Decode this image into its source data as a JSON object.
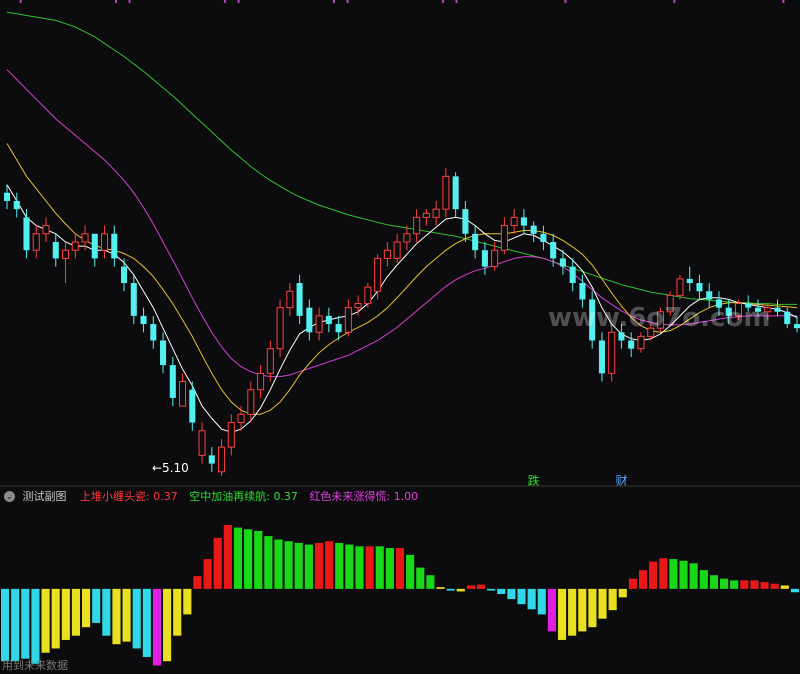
{
  "main_chart": {
    "low_marker": "←5.10",
    "event_labels": [
      {
        "text": "跌",
        "color": "#2ee02e",
        "index": 54
      },
      {
        "text": "财",
        "color": "#5aa8ff",
        "index": 63
      }
    ],
    "watermark": "www.6o7o.com",
    "colors": {
      "up": "#ff4040",
      "down": "#54f0f0",
      "ma_fast": "#ffffff",
      "ma_mid": "#e8c030",
      "ma_slow": "#d040d0",
      "ma_long": "#30c030"
    }
  },
  "sub_chart": {
    "title": "测试副图",
    "series": [
      {
        "name": "上堆小缠头瓷",
        "value": "0.37",
        "color": "#ff3a3a"
      },
      {
        "name": "空中加油再续航",
        "value": "0.37",
        "color": "#2ee02e"
      },
      {
        "name": "红色未来涨得慌",
        "value": "1.00",
        "color": "#e040e0"
      }
    ],
    "footer_note": "用到未来数据"
  },
  "chart_data": {
    "type": "candlestick",
    "candles": [
      [
        7.7,
        7.8,
        7.5,
        7.6
      ],
      [
        7.6,
        7.7,
        7.4,
        7.5
      ],
      [
        7.4,
        7.5,
        6.9,
        7.0
      ],
      [
        7.0,
        7.3,
        6.9,
        7.2
      ],
      [
        7.2,
        7.4,
        7.1,
        7.3
      ],
      [
        7.1,
        7.2,
        6.8,
        6.9
      ],
      [
        6.9,
        7.1,
        6.6,
        7.0
      ],
      [
        7.0,
        7.2,
        6.9,
        7.1
      ],
      [
        7.1,
        7.3,
        7.0,
        7.2
      ],
      [
        7.2,
        7.2,
        6.8,
        6.9
      ],
      [
        7.0,
        7.3,
        6.9,
        7.2
      ],
      [
        7.2,
        7.3,
        6.8,
        6.9
      ],
      [
        6.8,
        6.9,
        6.5,
        6.6
      ],
      [
        6.6,
        6.7,
        6.1,
        6.2
      ],
      [
        6.2,
        6.3,
        6.0,
        6.1
      ],
      [
        6.1,
        6.2,
        5.8,
        5.9
      ],
      [
        5.9,
        6.0,
        5.5,
        5.6
      ],
      [
        5.6,
        5.7,
        5.1,
        5.2
      ],
      [
        5.1,
        5.5,
        5.1,
        5.4
      ],
      [
        5.3,
        5.4,
        4.8,
        4.9
      ],
      [
        4.5,
        4.9,
        4.4,
        4.8
      ],
      [
        4.5,
        4.6,
        4.3,
        4.4
      ],
      [
        4.3,
        4.7,
        4.25,
        4.6
      ],
      [
        4.6,
        5.0,
        4.5,
        4.9
      ],
      [
        4.9,
        5.1,
        4.8,
        5.0
      ],
      [
        5.0,
        5.4,
        4.9,
        5.3
      ],
      [
        5.3,
        5.6,
        5.2,
        5.5
      ],
      [
        5.5,
        5.9,
        5.4,
        5.8
      ],
      [
        5.8,
        6.4,
        5.7,
        6.3
      ],
      [
        6.3,
        6.6,
        6.2,
        6.5
      ],
      [
        6.6,
        6.7,
        6.1,
        6.2
      ],
      [
        6.3,
        6.4,
        5.9,
        6.0
      ],
      [
        6.0,
        6.3,
        5.9,
        6.2
      ],
      [
        6.2,
        6.3,
        6.0,
        6.1
      ],
      [
        6.1,
        6.2,
        5.9,
        6.0
      ],
      [
        6.0,
        6.4,
        5.95,
        6.3
      ],
      [
        6.3,
        6.45,
        6.2,
        6.35
      ],
      [
        6.35,
        6.6,
        6.3,
        6.55
      ],
      [
        6.5,
        6.95,
        6.4,
        6.9
      ],
      [
        6.9,
        7.1,
        6.8,
        7.0
      ],
      [
        6.9,
        7.2,
        6.85,
        7.1
      ],
      [
        7.1,
        7.3,
        7.0,
        7.2
      ],
      [
        7.2,
        7.5,
        7.1,
        7.4
      ],
      [
        7.4,
        7.5,
        7.3,
        7.45
      ],
      [
        7.4,
        7.6,
        7.3,
        7.5
      ],
      [
        7.5,
        8.0,
        7.4,
        7.9
      ],
      [
        7.9,
        7.95,
        7.4,
        7.5
      ],
      [
        7.5,
        7.6,
        7.1,
        7.2
      ],
      [
        7.2,
        7.3,
        6.9,
        7.0
      ],
      [
        7.0,
        7.1,
        6.7,
        6.8
      ],
      [
        6.8,
        7.1,
        6.75,
        7.0
      ],
      [
        7.0,
        7.4,
        6.95,
        7.3
      ],
      [
        7.3,
        7.5,
        7.2,
        7.4
      ],
      [
        7.4,
        7.5,
        7.2,
        7.3
      ],
      [
        7.3,
        7.35,
        7.1,
        7.2
      ],
      [
        7.2,
        7.3,
        7.0,
        7.1
      ],
      [
        7.1,
        7.2,
        6.8,
        6.9
      ],
      [
        6.9,
        7.0,
        6.7,
        6.8
      ],
      [
        6.8,
        6.9,
        6.5,
        6.6
      ],
      [
        6.6,
        6.7,
        6.3,
        6.4
      ],
      [
        6.4,
        6.5,
        5.8,
        5.9
      ],
      [
        5.9,
        6.0,
        5.4,
        5.5
      ],
      [
        5.5,
        6.1,
        5.4,
        6.0
      ],
      [
        6.0,
        6.1,
        5.8,
        5.9
      ],
      [
        5.9,
        6.0,
        5.7,
        5.8
      ],
      [
        5.8,
        6.0,
        5.75,
        5.95
      ],
      [
        5.95,
        6.1,
        5.9,
        6.05
      ],
      [
        6.05,
        6.3,
        6.0,
        6.25
      ],
      [
        6.25,
        6.5,
        6.2,
        6.45
      ],
      [
        6.45,
        6.7,
        6.4,
        6.65
      ],
      [
        6.65,
        6.8,
        6.5,
        6.6
      ],
      [
        6.6,
        6.7,
        6.4,
        6.5
      ],
      [
        6.5,
        6.6,
        6.3,
        6.4
      ],
      [
        6.4,
        6.5,
        6.2,
        6.3
      ],
      [
        6.3,
        6.4,
        6.1,
        6.2
      ],
      [
        6.2,
        6.4,
        6.15,
        6.35
      ],
      [
        6.35,
        6.45,
        6.25,
        6.3
      ],
      [
        6.3,
        6.4,
        6.2,
        6.25
      ],
      [
        6.25,
        6.35,
        6.15,
        6.3
      ],
      [
        6.3,
        6.4,
        6.2,
        6.25
      ],
      [
        6.25,
        6.3,
        6.05,
        6.1
      ],
      [
        6.1,
        6.2,
        6.0,
        6.05
      ]
    ],
    "ma_fast": [
      7.8,
      7.6,
      7.4,
      7.3,
      7.25,
      7.2,
      7.1,
      7.05,
      7.05,
      7.0,
      7.0,
      6.95,
      6.85,
      6.7,
      6.5,
      6.3,
      6.05,
      5.8,
      5.55,
      5.35,
      5.1,
      4.95,
      4.82,
      4.78,
      4.82,
      4.92,
      5.08,
      5.3,
      5.55,
      5.78,
      5.98,
      6.06,
      6.12,
      6.15,
      6.18,
      6.2,
      6.25,
      6.35,
      6.5,
      6.68,
      6.82,
      6.95,
      7.08,
      7.18,
      7.28,
      7.38,
      7.4,
      7.38,
      7.3,
      7.2,
      7.12,
      7.1,
      7.15,
      7.2,
      7.18,
      7.12,
      7.05,
      6.98,
      6.88,
      6.75,
      6.55,
      6.3,
      6.1,
      5.98,
      5.92,
      5.9,
      5.92,
      5.98,
      6.08,
      6.2,
      6.32,
      6.4,
      6.42,
      6.42,
      6.4,
      6.36,
      6.34,
      6.32,
      6.3,
      6.28,
      6.24,
      6.18
    ],
    "ma_mid": [
      8.3,
      8.1,
      7.9,
      7.75,
      7.6,
      7.45,
      7.32,
      7.2,
      7.12,
      7.06,
      7.02,
      7.0,
      6.96,
      6.9,
      6.8,
      6.68,
      6.52,
      6.35,
      6.15,
      5.95,
      5.72,
      5.5,
      5.3,
      5.15,
      5.05,
      5.0,
      5.0,
      5.05,
      5.15,
      5.3,
      5.48,
      5.62,
      5.75,
      5.85,
      5.93,
      6.0,
      6.06,
      6.12,
      6.2,
      6.3,
      6.42,
      6.55,
      6.68,
      6.8,
      6.9,
      7.0,
      7.08,
      7.14,
      7.18,
      7.2,
      7.2,
      7.2,
      7.22,
      7.24,
      7.24,
      7.22,
      7.18,
      7.12,
      7.04,
      6.95,
      6.82,
      6.65,
      6.48,
      6.32,
      6.18,
      6.08,
      6.02,
      6.0,
      6.02,
      6.08,
      6.16,
      6.24,
      6.3,
      6.34,
      6.36,
      6.36,
      6.35,
      6.34,
      6.33,
      6.32,
      6.31,
      6.3
    ],
    "ma_slow": [
      9.2,
      9.08,
      8.96,
      8.84,
      8.72,
      8.6,
      8.5,
      8.4,
      8.3,
      8.2,
      8.1,
      7.98,
      7.85,
      7.7,
      7.52,
      7.32,
      7.1,
      6.88,
      6.65,
      6.42,
      6.2,
      6.0,
      5.82,
      5.68,
      5.58,
      5.52,
      5.48,
      5.46,
      5.46,
      5.48,
      5.52,
      5.56,
      5.6,
      5.64,
      5.68,
      5.72,
      5.78,
      5.84,
      5.9,
      5.98,
      6.06,
      6.16,
      6.26,
      6.36,
      6.46,
      6.56,
      6.64,
      6.7,
      6.75,
      6.78,
      6.82,
      6.86,
      6.9,
      6.92,
      6.92,
      6.9,
      6.86,
      6.8,
      6.72,
      6.62,
      6.52,
      6.42,
      6.34,
      6.26,
      6.2,
      6.15,
      6.12,
      6.1,
      6.09,
      6.09,
      6.1,
      6.12,
      6.14,
      6.16,
      6.18,
      6.19,
      6.2,
      6.2,
      6.2,
      6.2,
      6.2,
      6.2
    ],
    "ma_long": [
      9.9,
      9.88,
      9.86,
      9.84,
      9.82,
      9.8,
      9.76,
      9.72,
      9.66,
      9.6,
      9.52,
      9.44,
      9.36,
      9.27,
      9.18,
      9.08,
      8.98,
      8.88,
      8.77,
      8.66,
      8.55,
      8.44,
      8.33,
      8.22,
      8.12,
      8.02,
      7.93,
      7.85,
      7.78,
      7.71,
      7.65,
      7.6,
      7.55,
      7.51,
      7.47,
      7.43,
      7.4,
      7.37,
      7.34,
      7.31,
      7.29,
      7.27,
      7.25,
      7.23,
      7.21,
      7.19,
      7.17,
      7.14,
      7.11,
      7.08,
      7.05,
      7.02,
      6.99,
      6.96,
      6.93,
      6.9,
      6.86,
      6.82,
      6.78,
      6.74,
      6.7,
      6.66,
      6.62,
      6.58,
      6.55,
      6.52,
      6.49,
      6.47,
      6.45,
      6.43,
      6.41,
      6.4,
      6.39,
      6.38,
      6.37,
      6.36,
      6.36,
      6.35,
      6.35,
      6.34,
      6.34,
      6.34
    ],
    "sub_bars": [
      {
        "v": -0.85,
        "c": "cyan"
      },
      {
        "v": -0.85,
        "c": "cyan"
      },
      {
        "v": -0.82,
        "c": "cyan"
      },
      {
        "v": -0.88,
        "c": "cyan"
      },
      {
        "v": -0.75,
        "c": "yellow"
      },
      {
        "v": -0.7,
        "c": "yellow"
      },
      {
        "v": -0.6,
        "c": "yellow"
      },
      {
        "v": -0.55,
        "c": "yellow"
      },
      {
        "v": -0.45,
        "c": "yellow"
      },
      {
        "v": -0.4,
        "c": "cyan"
      },
      {
        "v": -0.55,
        "c": "cyan"
      },
      {
        "v": -0.65,
        "c": "yellow"
      },
      {
        "v": -0.62,
        "c": "yellow"
      },
      {
        "v": -0.7,
        "c": "cyan"
      },
      {
        "v": -0.8,
        "c": "cyan"
      },
      {
        "v": -0.9,
        "c": "magenta"
      },
      {
        "v": -0.85,
        "c": "yellow"
      },
      {
        "v": -0.55,
        "c": "yellow"
      },
      {
        "v": -0.3,
        "c": "yellow"
      },
      {
        "v": 0.15,
        "c": "red"
      },
      {
        "v": 0.35,
        "c": "red"
      },
      {
        "v": 0.6,
        "c": "red"
      },
      {
        "v": 0.75,
        "c": "red"
      },
      {
        "v": 0.72,
        "c": "green"
      },
      {
        "v": 0.7,
        "c": "green"
      },
      {
        "v": 0.68,
        "c": "green"
      },
      {
        "v": 0.62,
        "c": "green"
      },
      {
        "v": 0.58,
        "c": "green"
      },
      {
        "v": 0.56,
        "c": "green"
      },
      {
        "v": 0.54,
        "c": "green"
      },
      {
        "v": 0.52,
        "c": "green"
      },
      {
        "v": 0.54,
        "c": "red"
      },
      {
        "v": 0.56,
        "c": "red"
      },
      {
        "v": 0.54,
        "c": "green"
      },
      {
        "v": 0.52,
        "c": "green"
      },
      {
        "v": 0.5,
        "c": "green"
      },
      {
        "v": 0.5,
        "c": "red"
      },
      {
        "v": 0.5,
        "c": "green"
      },
      {
        "v": 0.48,
        "c": "green"
      },
      {
        "v": 0.48,
        "c": "red"
      },
      {
        "v": 0.4,
        "c": "green"
      },
      {
        "v": 0.25,
        "c": "green"
      },
      {
        "v": 0.16,
        "c": "green"
      },
      {
        "v": 0.02,
        "c": "yellow"
      },
      {
        "v": -0.02,
        "c": "cyan"
      },
      {
        "v": -0.03,
        "c": "yellow"
      },
      {
        "v": 0.04,
        "c": "red"
      },
      {
        "v": 0.05,
        "c": "red"
      },
      {
        "v": -0.02,
        "c": "cyan"
      },
      {
        "v": -0.06,
        "c": "cyan"
      },
      {
        "v": -0.12,
        "c": "cyan"
      },
      {
        "v": -0.18,
        "c": "cyan"
      },
      {
        "v": -0.24,
        "c": "cyan"
      },
      {
        "v": -0.3,
        "c": "cyan"
      },
      {
        "v": -0.5,
        "c": "magenta"
      },
      {
        "v": -0.6,
        "c": "yellow"
      },
      {
        "v": -0.55,
        "c": "yellow"
      },
      {
        "v": -0.5,
        "c": "yellow"
      },
      {
        "v": -0.45,
        "c": "yellow"
      },
      {
        "v": -0.35,
        "c": "yellow"
      },
      {
        "v": -0.25,
        "c": "yellow"
      },
      {
        "v": -0.1,
        "c": "yellow"
      },
      {
        "v": 0.12,
        "c": "red"
      },
      {
        "v": 0.22,
        "c": "red"
      },
      {
        "v": 0.32,
        "c": "red"
      },
      {
        "v": 0.36,
        "c": "red"
      },
      {
        "v": 0.35,
        "c": "green"
      },
      {
        "v": 0.33,
        "c": "green"
      },
      {
        "v": 0.3,
        "c": "green"
      },
      {
        "v": 0.22,
        "c": "green"
      },
      {
        "v": 0.16,
        "c": "green"
      },
      {
        "v": 0.12,
        "c": "green"
      },
      {
        "v": 0.1,
        "c": "green"
      },
      {
        "v": 0.1,
        "c": "red"
      },
      {
        "v": 0.1,
        "c": "red"
      },
      {
        "v": 0.08,
        "c": "red"
      },
      {
        "v": 0.06,
        "c": "red"
      },
      {
        "v": 0.04,
        "c": "yellow"
      },
      {
        "v": -0.04,
        "c": "cyan"
      }
    ],
    "price_range": [
      4.2,
      10.0
    ],
    "sub_range": [
      -1.0,
      0.95
    ]
  }
}
